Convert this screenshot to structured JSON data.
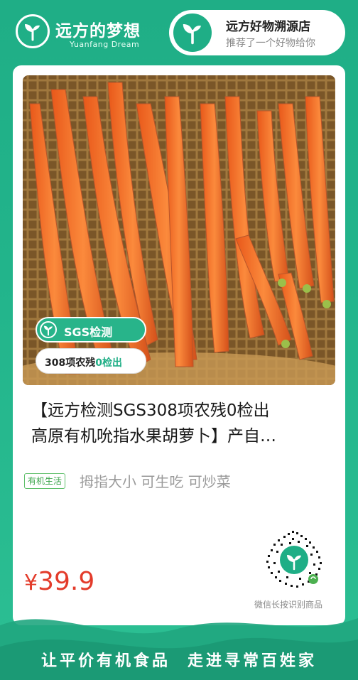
{
  "brand": {
    "name": "远方的梦想",
    "subtitle": "Yuanfang Dream"
  },
  "store": {
    "name": "远方好物溯源店",
    "subtitle": "推荐了一个好物给你"
  },
  "product": {
    "badges": {
      "sgs": "SGS检测",
      "result_prefix": "308项农残",
      "result_zero": "0检出"
    },
    "title_line1": "【远方检测SGS308项农残0检出",
    "title_line2": "高原有机吮指水果胡萝卜】产自…",
    "tag": "有机生活",
    "tag_desc": "拇指大小 可生吃 可炒菜",
    "price_symbol": "¥",
    "price": "39.9"
  },
  "qr": {
    "caption": "微信长按识别商品"
  },
  "footer": {
    "slogan_left": "让平价有机食品",
    "slogan_right": "走进寻常百姓家"
  },
  "colors": {
    "primary": "#1fae86",
    "price": "#e33b2a",
    "tag": "#3aa54a"
  },
  "icons": {
    "brand_logo": "sprout-leaf-icon",
    "store_logo": "sprout-leaf-icon",
    "sgs": "sprout-leaf-icon",
    "qr": "qr-code-icon"
  }
}
